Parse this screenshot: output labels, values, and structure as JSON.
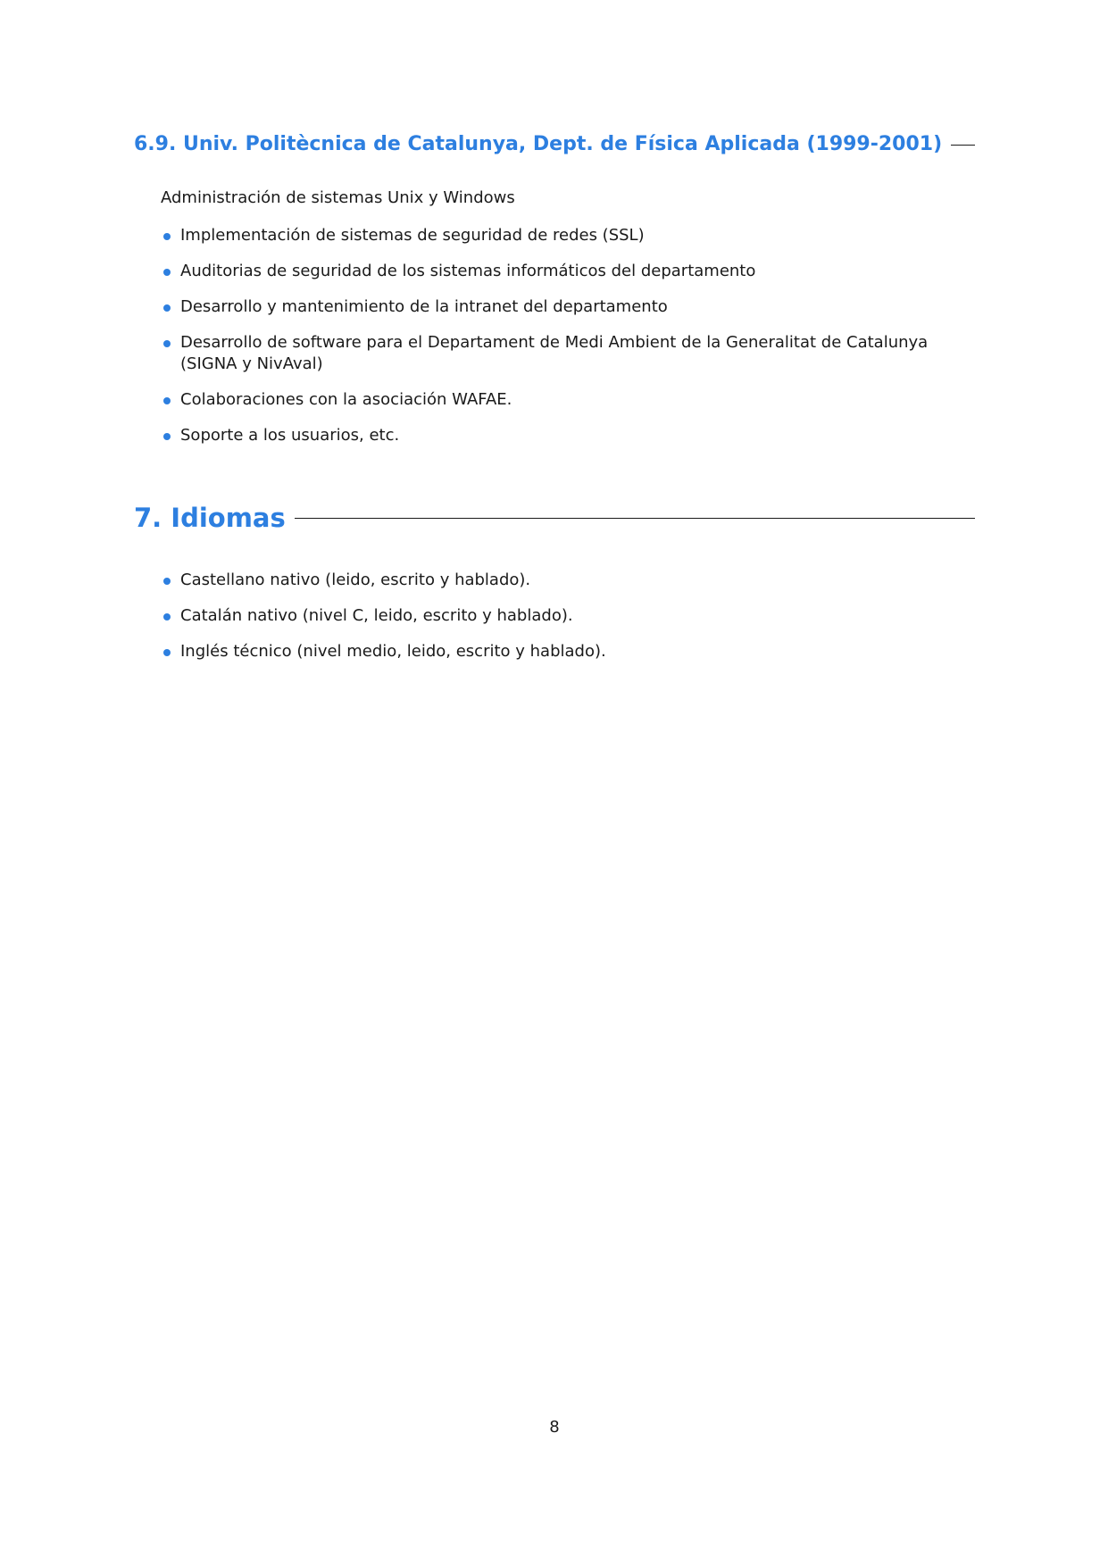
{
  "section_6_9": {
    "title": "6.9. Univ. Politècnica de Catalunya, Dept. de Física Aplicada (1999-2001)",
    "intro": "Administración de sistemas Unix y Windows",
    "items": [
      "Implementación de sistemas de seguridad de redes (SSL)",
      "Auditorias de seguridad de los sistemas informáticos del departamento",
      "Desarrollo y mantenimiento de la intranet del departamento",
      "Desarrollo de software para el Departament de Medi Ambient de la Generalitat de Catalunya (SIGNA y NivAval)",
      "Colaboraciones con la asociación WAFAE.",
      "Soporte a los usuarios, etc."
    ]
  },
  "section_7": {
    "title": "7. Idiomas",
    "items": [
      "Castellano nativo (leido, escrito y hablado).",
      "Catalán nativo (nivel C, leido, escrito y hablado).",
      "Inglés técnico (nivel medio, leido, escrito y hablado)."
    ]
  },
  "footer": {
    "page_number": "8"
  },
  "colors": {
    "accent": "#2d7fe0",
    "text": "#1a1a1a"
  },
  "icons": {
    "bullet": "bullet-dot-icon"
  }
}
